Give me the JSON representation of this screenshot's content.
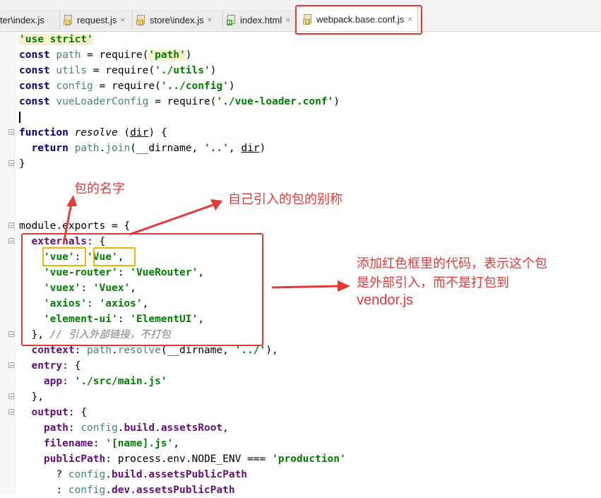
{
  "tabs": [
    {
      "label": "ter\\index.js",
      "icon": "js-file-icon",
      "active": false
    },
    {
      "label": "request.js",
      "icon": "js-file-icon",
      "active": false
    },
    {
      "label": "store\\index.js",
      "icon": "js-file-icon",
      "active": false
    },
    {
      "label": "index.html",
      "icon": "html-file-icon",
      "active": false
    },
    {
      "label": "webpack.base.conf.js",
      "icon": "js-file-icon",
      "active": true
    }
  ],
  "close_glyph": "×",
  "file_badges": {
    "js": "JS",
    "html": "H"
  },
  "code": {
    "use_strict": "'use strict'",
    "const": "const",
    "require": "require",
    "var_path": "path",
    "var_utils": "utils",
    "var_config": "config",
    "var_vueLoaderConfig": "vueLoaderConfig",
    "str_path": "'path'",
    "str_utils": "'./utils'",
    "str_config": "'../config'",
    "str_vueloader": "'./vue-loader.conf'",
    "function": "function",
    "resolve": "resolve",
    "dir": "dir",
    "return": "return",
    "join": "join",
    "dirname": "__dirname",
    "str_dotdot": "'..'",
    "module": "module",
    "exports": "exports",
    "externals": "externals",
    "ext_vue_key": "'vue'",
    "ext_vue_val": "'Vue'",
    "ext_router_key": "'vue-router'",
    "ext_router_val": "'VueRouter'",
    "ext_vuex_key": "'vuex'",
    "ext_vuex_val": "'Vuex'",
    "ext_axios_key": "'axios'",
    "ext_axios_val": "'axios'",
    "ext_element_key": "'element-ui'",
    "ext_element_val": "'ElementUI'",
    "comment_externals": "// 引入外部链接，不打包",
    "context": "context",
    "str_ctx": "'../'",
    "entry": "entry",
    "app": "app",
    "str_main": "'./src/main.js'",
    "output": "output",
    "path_key": "path",
    "build": "build",
    "assetsRoot": "assetsRoot",
    "filename": "filename",
    "str_name": "'[name].js'",
    "publicPath": "publicPath",
    "process": "process",
    "env": "env",
    "NODE_ENV": "NODE_ENV",
    "str_production": "'production'",
    "assetsPublicPath": "assetsPublicPath",
    "dev": "dev"
  },
  "annotations": {
    "package_name": "包的名字",
    "alias": "自己引入的包的别称",
    "explain_line1": "添加红色框里的代码，表示这个包",
    "explain_line2": "是外部引入，而不是打包到",
    "explain_line3": "vendor.js"
  },
  "colors": {
    "keyword": "#000080",
    "string": "#008000",
    "property": "#660e7a",
    "variable": "#458383",
    "comment": "#808080",
    "annotation": "#e53935",
    "highlight_box": "#f2b400"
  }
}
